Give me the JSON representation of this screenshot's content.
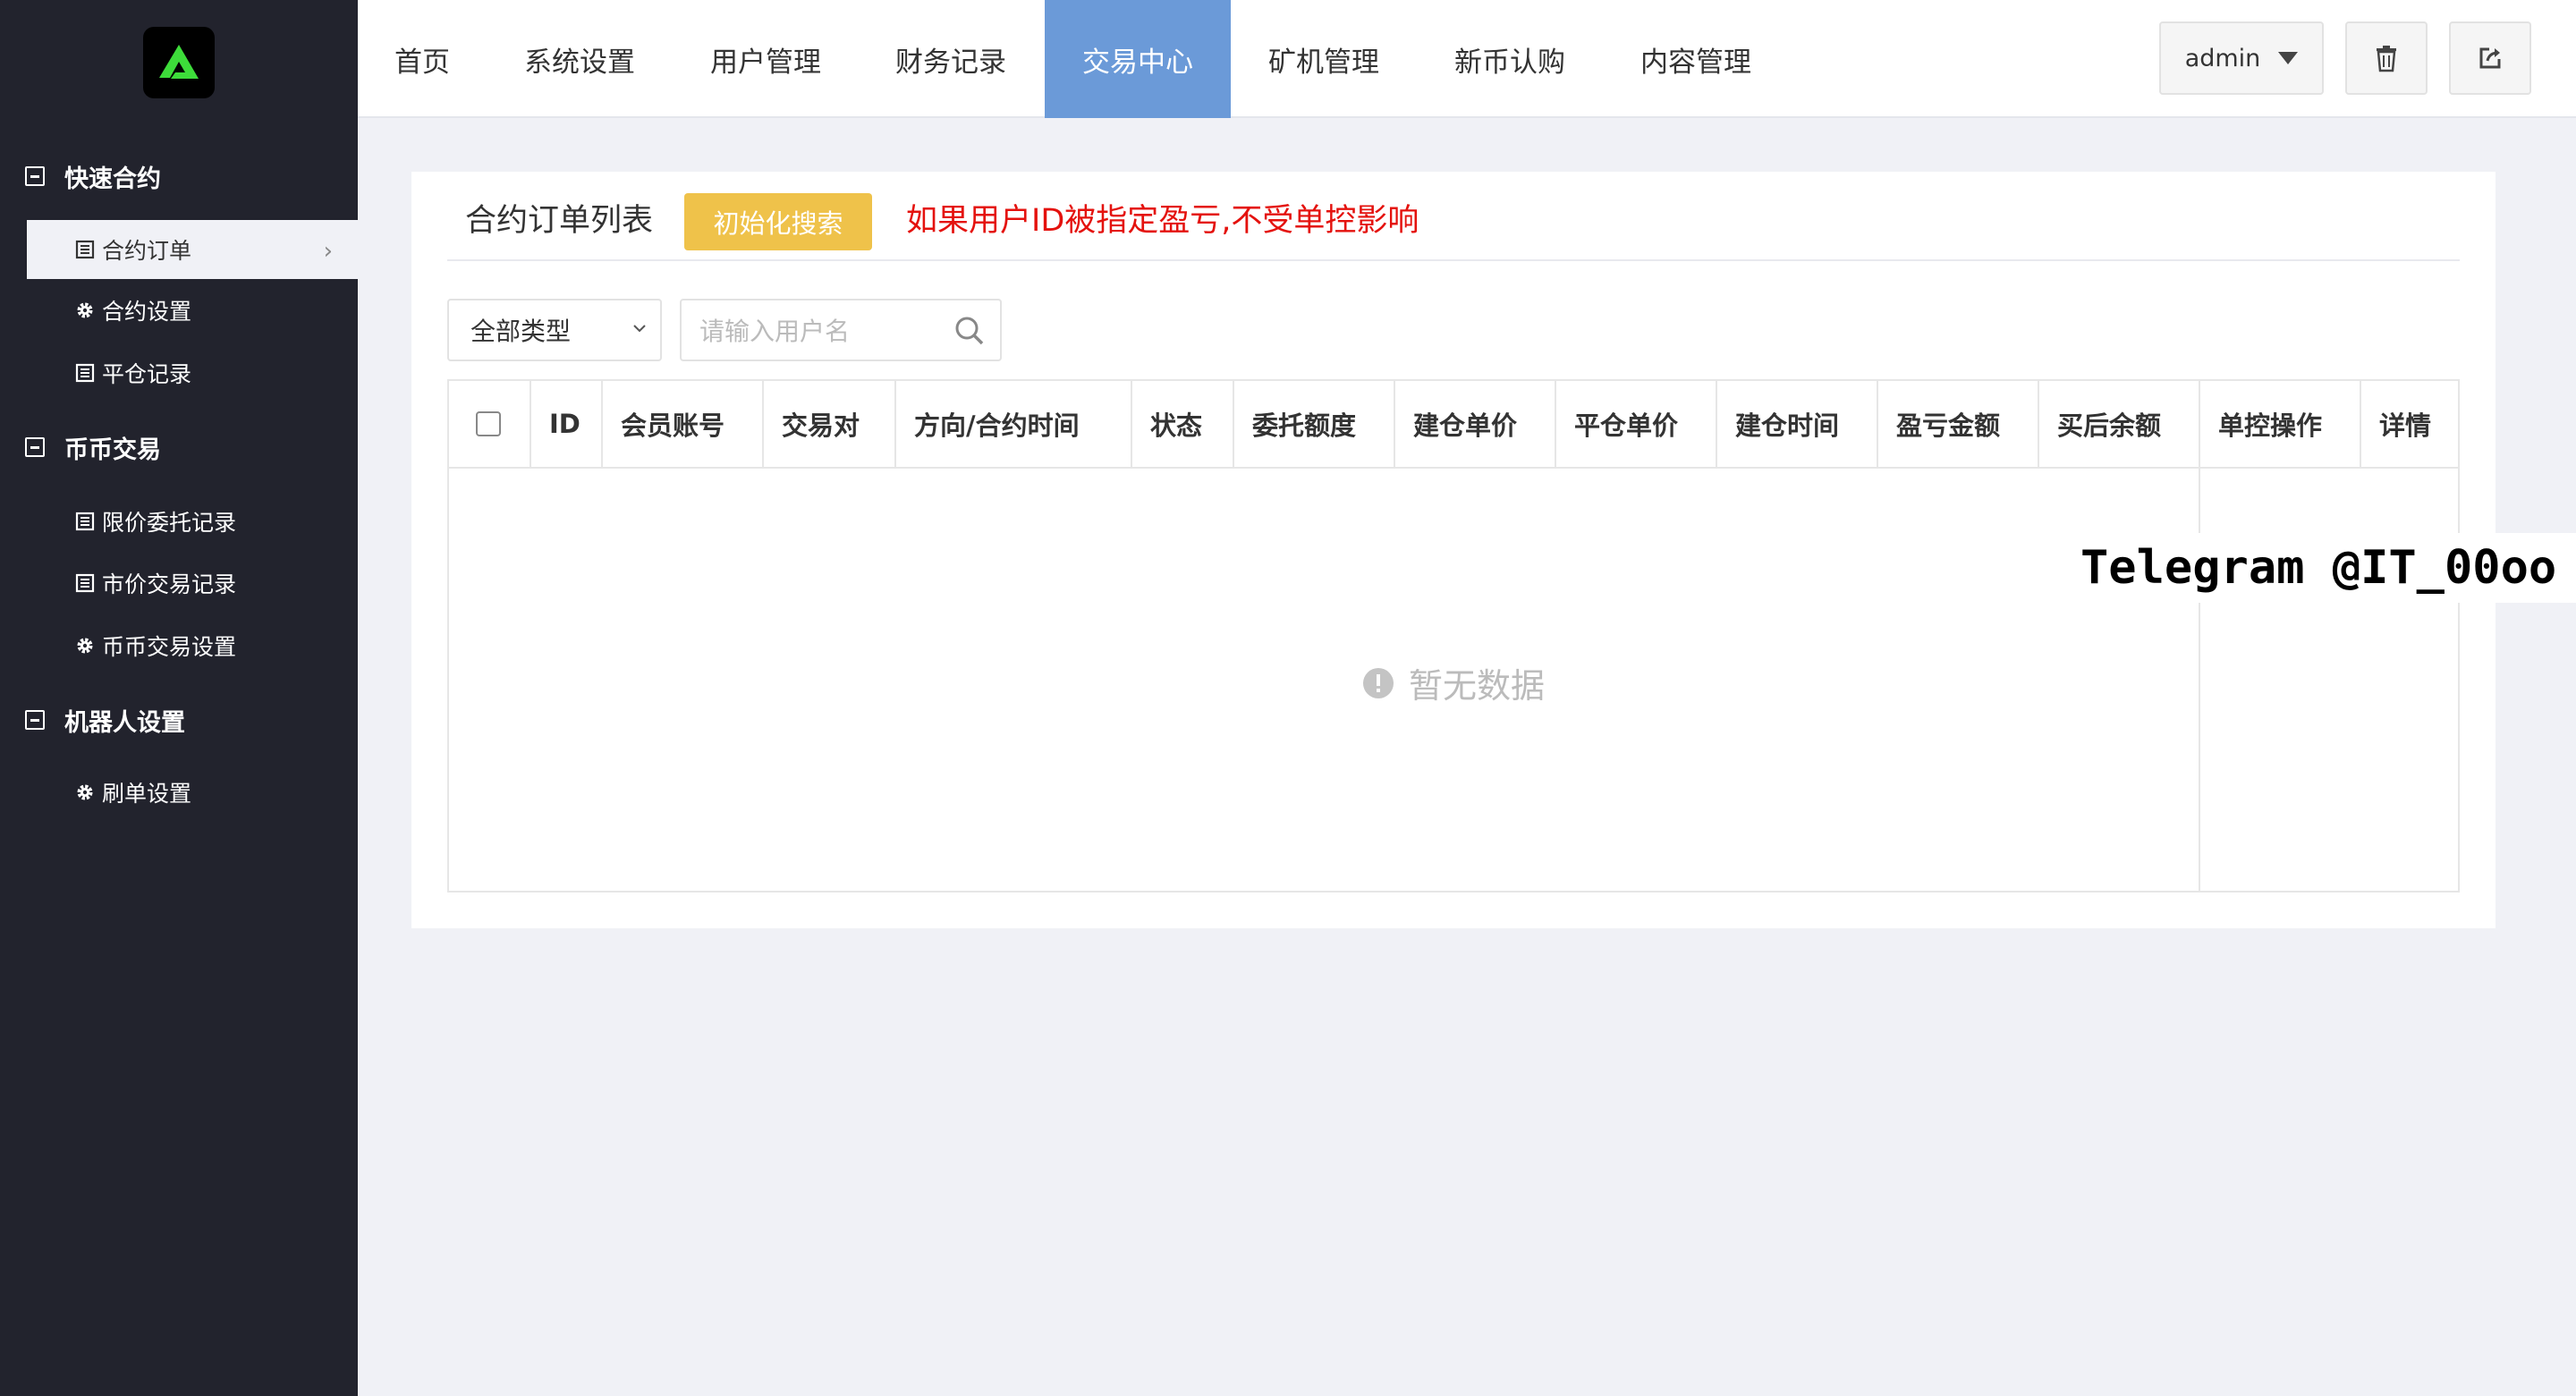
{
  "sidebar": {
    "groups": [
      {
        "title": "快速合约",
        "items": [
          {
            "label": "合约订单",
            "icon": "list-icon"
          },
          {
            "label": "合约设置",
            "icon": "gear-icon"
          },
          {
            "label": "平仓记录",
            "icon": "list-icon"
          }
        ]
      },
      {
        "title": "币币交易",
        "items": [
          {
            "label": "限价委托记录",
            "icon": "list-icon"
          },
          {
            "label": "市价交易记录",
            "icon": "list-icon"
          },
          {
            "label": "币币交易设置",
            "icon": "gear-icon"
          }
        ]
      },
      {
        "title": "机器人设置",
        "items": [
          {
            "label": "刷单设置",
            "icon": "gear-icon"
          }
        ]
      }
    ]
  },
  "topnav": {
    "items": [
      "首页",
      "系统设置",
      "用户管理",
      "财务记录",
      "交易中心",
      "矿机管理",
      "新币认购",
      "内容管理"
    ],
    "active_index": 4,
    "user": "admin"
  },
  "main": {
    "title": "合约订单列表",
    "reset_label": "初始化搜索",
    "notice": "如果用户ID被指定盈亏,不受单控影响",
    "filter": {
      "type_selected": "全部类型",
      "search_placeholder": "请输入用户名"
    },
    "table": {
      "columns": [
        "ID",
        "会员账号",
        "交易对",
        "方向/合约时间",
        "状态",
        "委托额度",
        "建仓单价",
        "平仓单价",
        "建仓时间",
        "盈亏金额",
        "买后余额",
        "单控操作",
        "详情"
      ],
      "rows": [],
      "empty_text": "暂无数据"
    }
  },
  "watermark": "Telegram @IT_00oo",
  "colors": {
    "sidebar_bg": "#22232d",
    "active_nav": "#6b9ad8",
    "reset_button": "#efc24a",
    "notice": "#e4120e",
    "logo_green": "#3ddc3a"
  }
}
